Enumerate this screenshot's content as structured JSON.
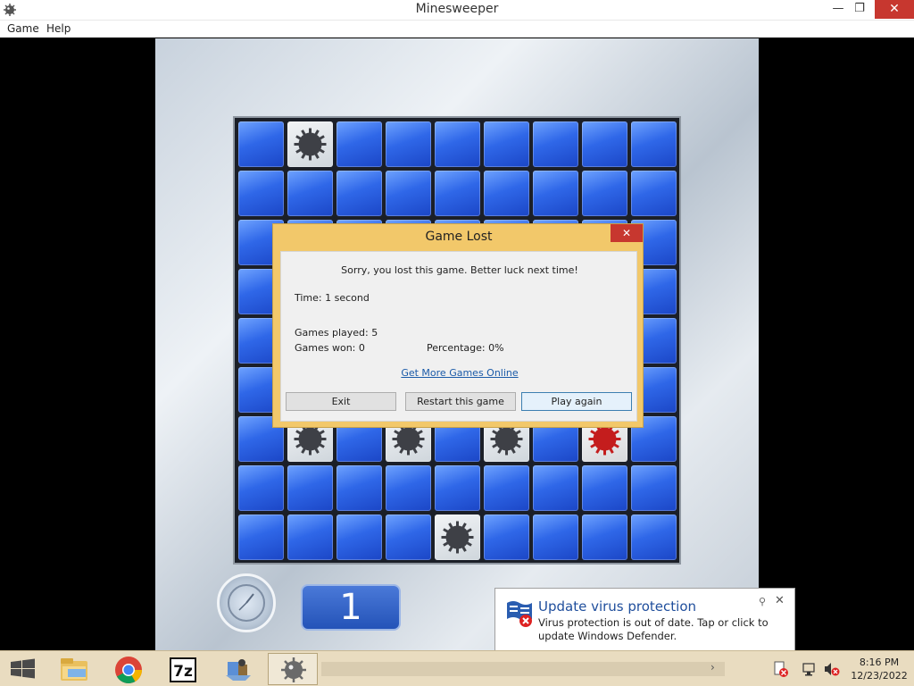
{
  "window": {
    "title": "Minesweeper",
    "minimize_label": "—",
    "maximize_label": "❐",
    "close_label": "✕"
  },
  "menu": {
    "items": [
      "Game",
      "Help"
    ]
  },
  "game": {
    "timer_value": "1"
  },
  "dialog": {
    "title": "Game Lost",
    "close_label": "✕",
    "message": "Sorry, you lost this game. Better luck next time!",
    "time": "Time: 1 second",
    "games_played": "Games played: 5",
    "games_won": "Games won: 0",
    "percentage": "Percentage: 0%",
    "link": "Get More Games Online",
    "buttons": {
      "exit": "Exit",
      "restart": "Restart this game",
      "play_again": "Play again"
    }
  },
  "notification": {
    "title": "Update virus protection",
    "body": "Virus protection is out of date. Tap or click to update Windows Defender.",
    "close_label": "✕",
    "pin_label": "⚲"
  },
  "taskbar": {
    "apps": [
      "file-explorer-icon",
      "chrome-icon",
      "7zip-icon",
      "network-app-icon",
      "minesweeper-icon"
    ],
    "sevenzip_label": "7z",
    "scroll_arrow": "›",
    "clock_time": "8:16 PM",
    "clock_date": "12/23/2022"
  },
  "colors": {
    "cell_blue": "#2f67e8",
    "dialog_frame": "#f2c86a",
    "close_red": "#c7372f",
    "link_blue": "#1a5aa8"
  }
}
